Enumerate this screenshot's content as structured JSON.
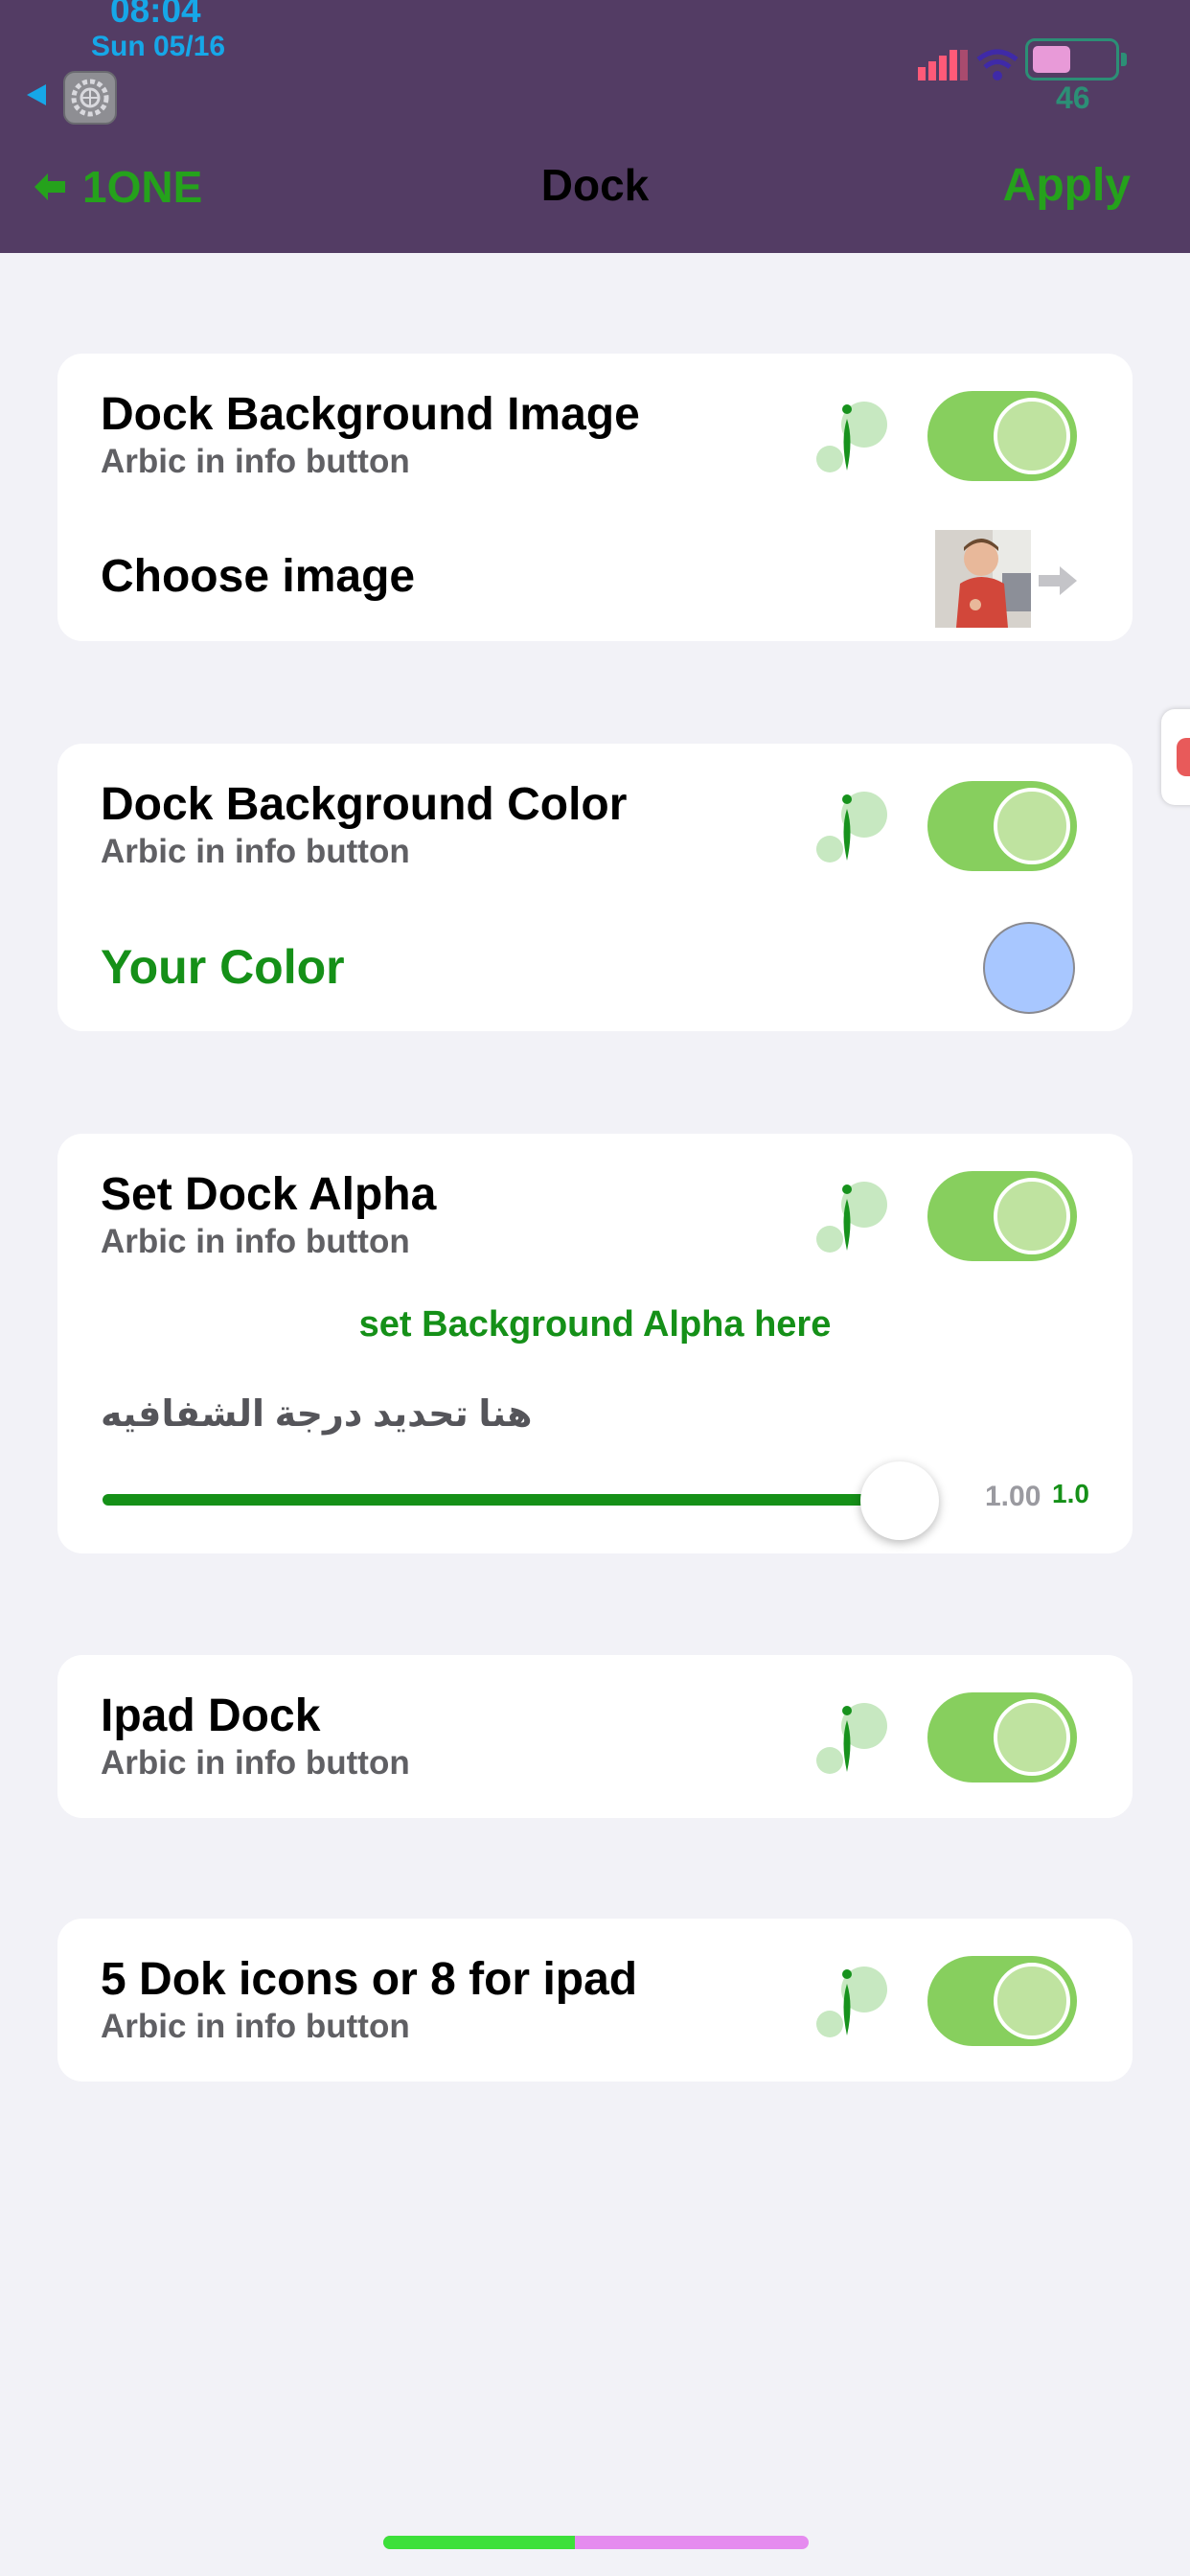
{
  "status_bar": {
    "time": "08:04",
    "date": "Sun 05/16",
    "battery_level": "46",
    "battery_fill_percent": 46
  },
  "nav": {
    "back_label": "1ONE",
    "title": "Dock",
    "apply_label": "Apply"
  },
  "sections": [
    {
      "title": "Dock Background Image",
      "subtitle": "Arbic in info button",
      "toggle_on": true,
      "choose_label": "Choose image"
    },
    {
      "title": "Dock Background Color",
      "subtitle": "Arbic in info button",
      "toggle_on": true,
      "color_label": "Your Color",
      "color_value": "#a8c7ff"
    },
    {
      "title": "Set Dock Alpha",
      "subtitle": "Arbic in info button",
      "toggle_on": true,
      "hint": "set Background Alpha here",
      "arabic_hint": "هنا تحديد درجة الشفافيه",
      "slider_value": 1.0,
      "slider_value_label": "1.00",
      "slider_value_label_2": "1.0"
    },
    {
      "title": "Ipad Dock",
      "subtitle": "Arbic in info button",
      "toggle_on": true
    },
    {
      "title": "5 Dok icons or 8 for ipad",
      "subtitle": "Arbic in info button",
      "toggle_on": true
    }
  ],
  "colors": {
    "header_bg": "#533c64",
    "accent_green": "#25a21c",
    "toggle_on": "#87cf5e",
    "status_blue": "#16a7e8"
  },
  "home_indicator_progress": 0.45
}
